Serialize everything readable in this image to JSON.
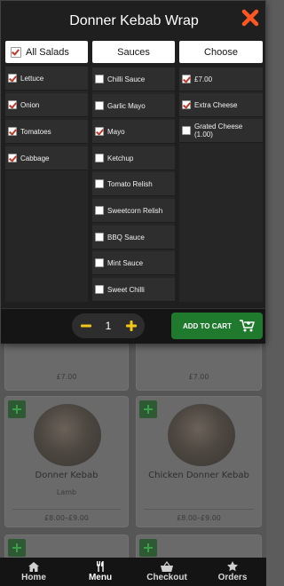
{
  "modal": {
    "title": "Donner Kebab Wrap",
    "columns": [
      {
        "header": "All Salads",
        "header_checked": true,
        "items": [
          {
            "label": "Lettuce",
            "checked": true
          },
          {
            "label": "Onion",
            "checked": true
          },
          {
            "label": "Tomatoes",
            "checked": true
          },
          {
            "label": "Cabbage",
            "checked": true
          }
        ]
      },
      {
        "header": "Sauces",
        "items": [
          {
            "label": "Chilli Sauce",
            "checked": false
          },
          {
            "label": "Garlic Mayo",
            "checked": false
          },
          {
            "label": "Mayo",
            "checked": true
          },
          {
            "label": "Ketchup",
            "checked": false
          },
          {
            "label": "Tomato Relish",
            "checked": false
          },
          {
            "label": "Sweetcorn Relish",
            "checked": false
          },
          {
            "label": "BBQ Sauce",
            "checked": false
          },
          {
            "label": "Mint Sauce",
            "checked": false
          },
          {
            "label": "Sweet Chilli",
            "checked": false
          }
        ]
      },
      {
        "header": "Choose",
        "items": [
          {
            "label": "£7.00",
            "checked": true
          },
          {
            "label": "Extra Cheese",
            "checked": true
          },
          {
            "label": "Grated Cheese (1.00)",
            "checked": false
          }
        ]
      }
    ],
    "quantity": "1",
    "add_to_cart_label": "ADD TO CART"
  },
  "menu_cards": [
    {
      "price": "£7.00"
    },
    {
      "price": "£7.00"
    },
    {
      "name": "Donner Kebab",
      "subtitle": "Lamb",
      "price": "£8.00–£9.00"
    },
    {
      "name": "Chicken Donner Kebab",
      "subtitle": "",
      "price": "£8.00–£9.00"
    }
  ],
  "nav": [
    {
      "label": "Home",
      "icon": "home-icon"
    },
    {
      "label": "Menu",
      "icon": "cutlery-icon"
    },
    {
      "label": "Checkout",
      "icon": "basket-icon"
    },
    {
      "label": "Orders",
      "icon": "star-icon"
    }
  ],
  "colors": {
    "accent_plus": "#f5c518",
    "close": "#ff5722",
    "add_to_cart": "#1f7a2e",
    "check": "#c0392b"
  }
}
